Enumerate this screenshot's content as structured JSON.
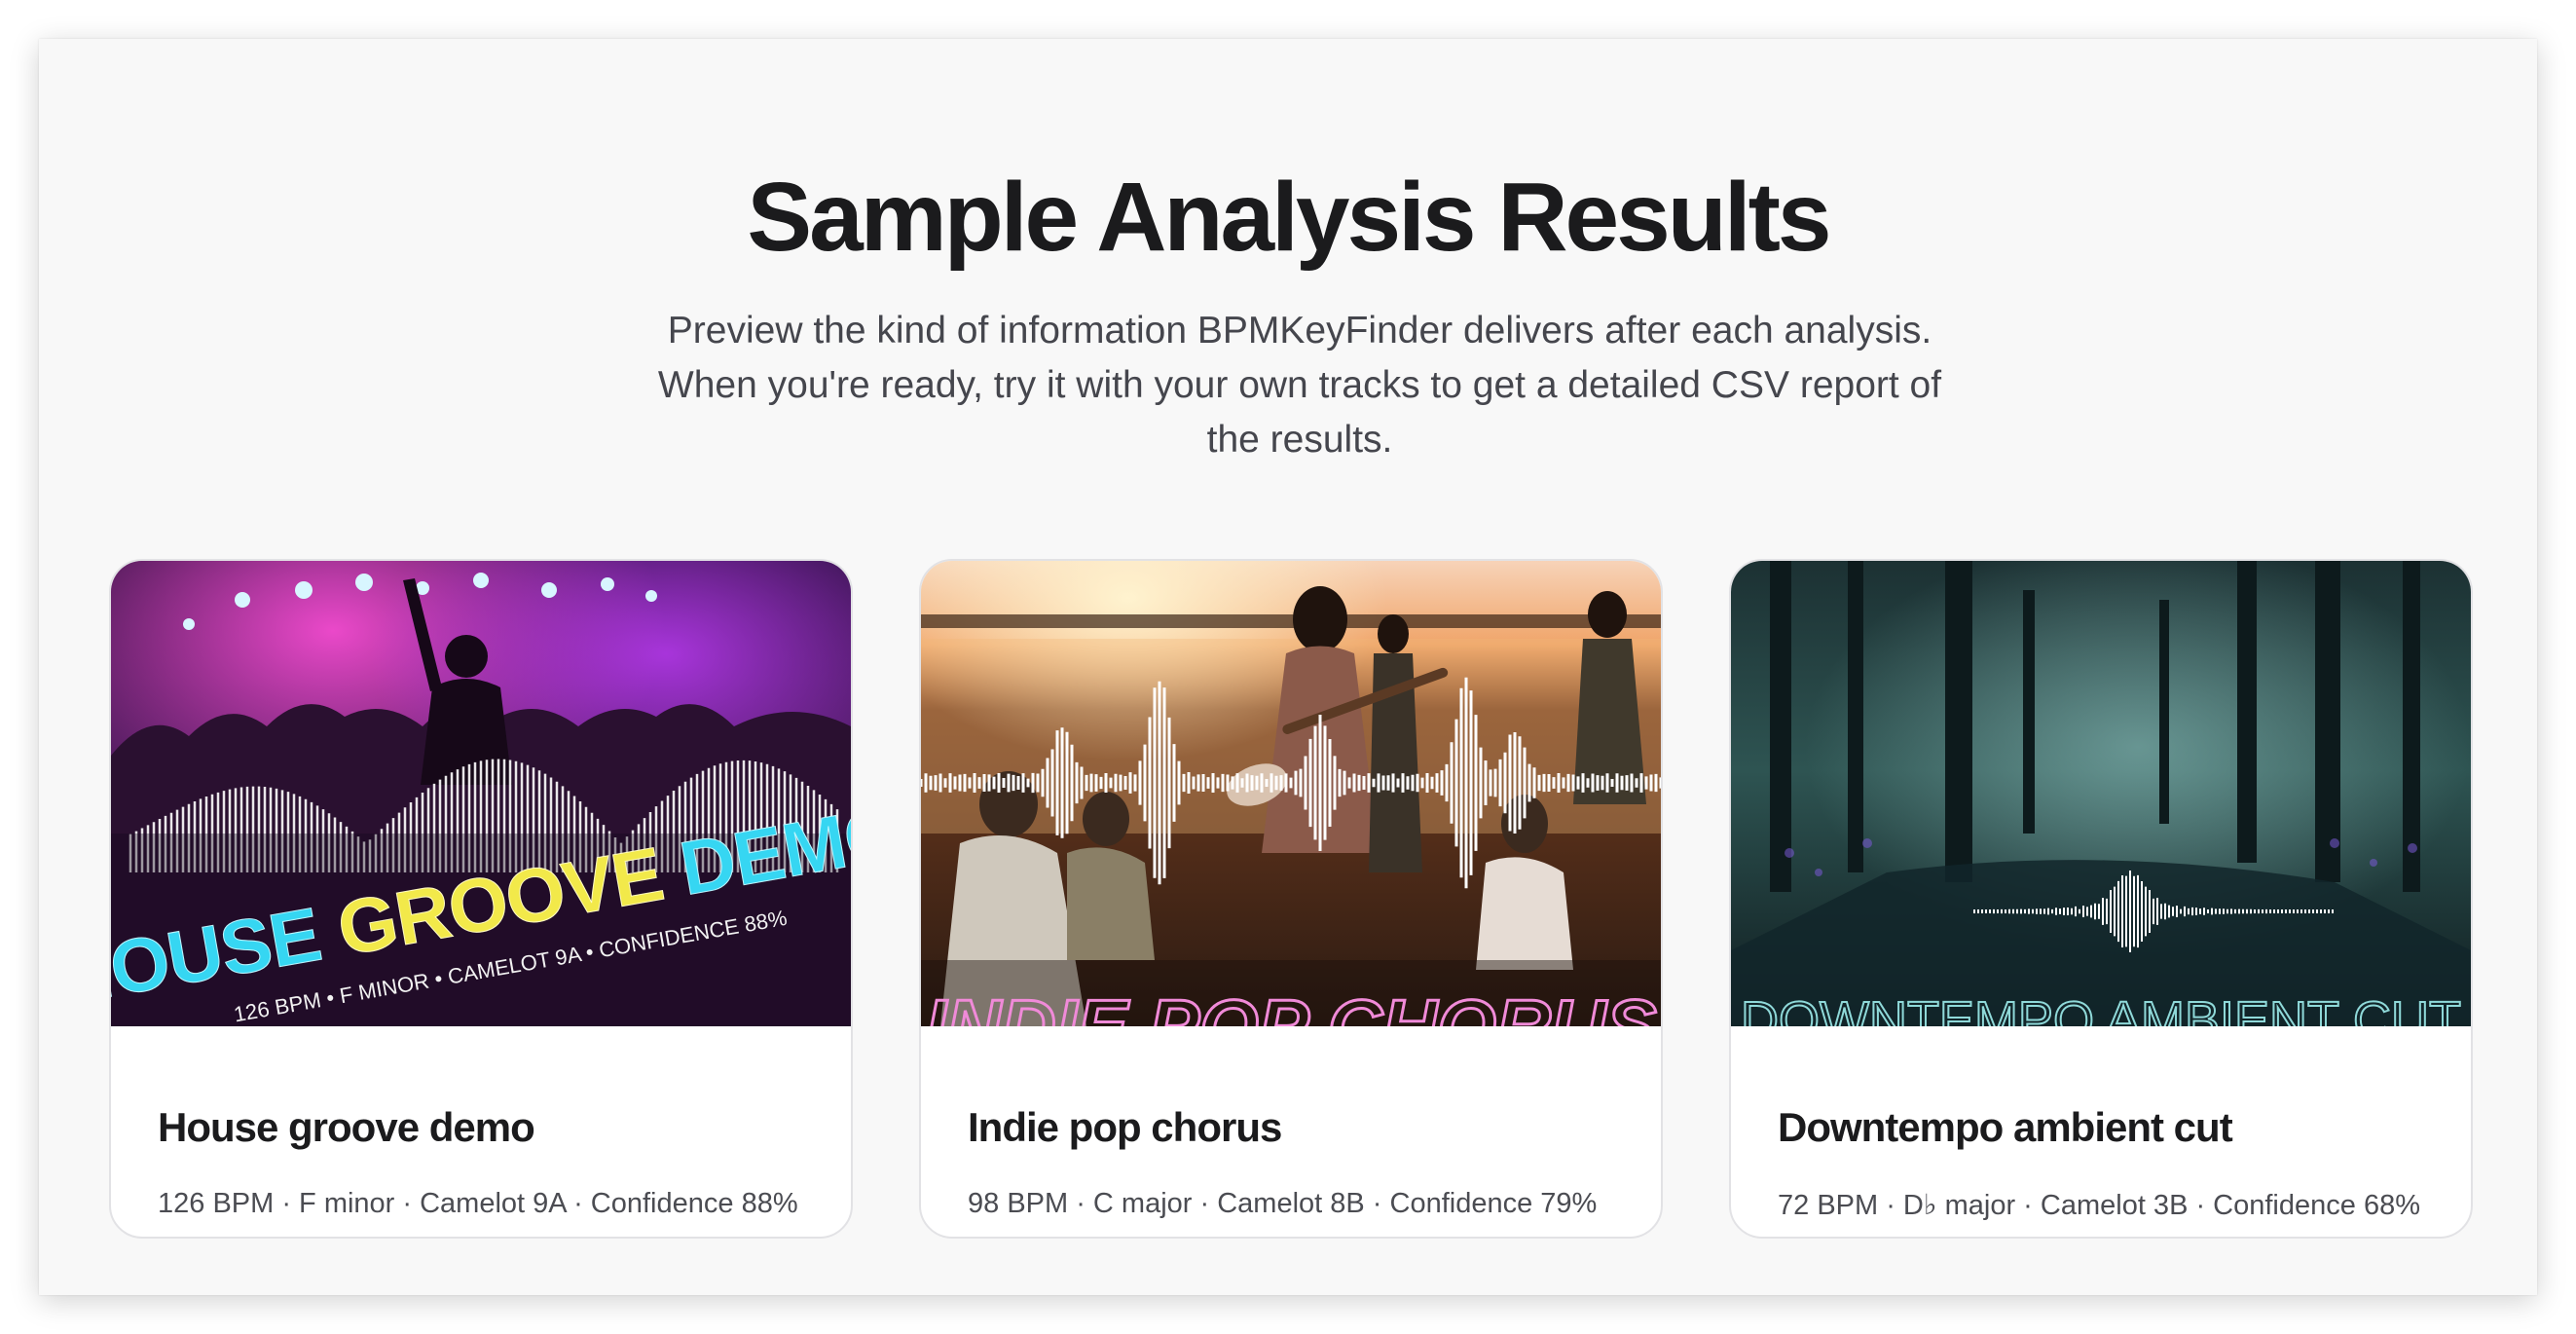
{
  "section": {
    "title": "Sample Analysis Results",
    "subtitle": "Preview the kind of information BPMKeyFinder delivers after each analysis. When you're ready, try it with your own tracks to get a detailed CSV report of the results."
  },
  "cards": [
    {
      "title": "House groove demo",
      "meta": "126 BPM · F minor · Camelot 9A · Confidence 88%",
      "image": {
        "scene": "dj-crowd-neon",
        "overlay_title_part1": "HOUSE ",
        "overlay_title_part2": "GROOVE",
        "overlay_title_part3": " DEMO",
        "overlay_subtitle": "126 BPM • F MINOR • CAMELOT 9A • CONFIDENCE 88%"
      }
    },
    {
      "title": "Indie pop chorus",
      "meta": "98 BPM · C major · Camelot 8B · Confidence 79%",
      "image": {
        "scene": "field-band-sunset",
        "overlay_title": "INDIE POP CHORUS"
      }
    },
    {
      "title": "Downtempo ambient cut",
      "meta": "72 BPM · D♭ major · Camelot 3B · Confidence 68%",
      "image": {
        "scene": "misty-forest-stream",
        "overlay_title": "DOWNTEMPO AMBIENT CUT"
      }
    }
  ],
  "colors": {
    "title": "#1b1b1d",
    "text_muted": "#45464d",
    "panel_bg": "#f8f8f8",
    "neon_cyan": "#36d6f2",
    "neon_yellow": "#f2e94a",
    "neon_pink": "#f08ad8",
    "neon_teal": "#8fd9d9"
  }
}
